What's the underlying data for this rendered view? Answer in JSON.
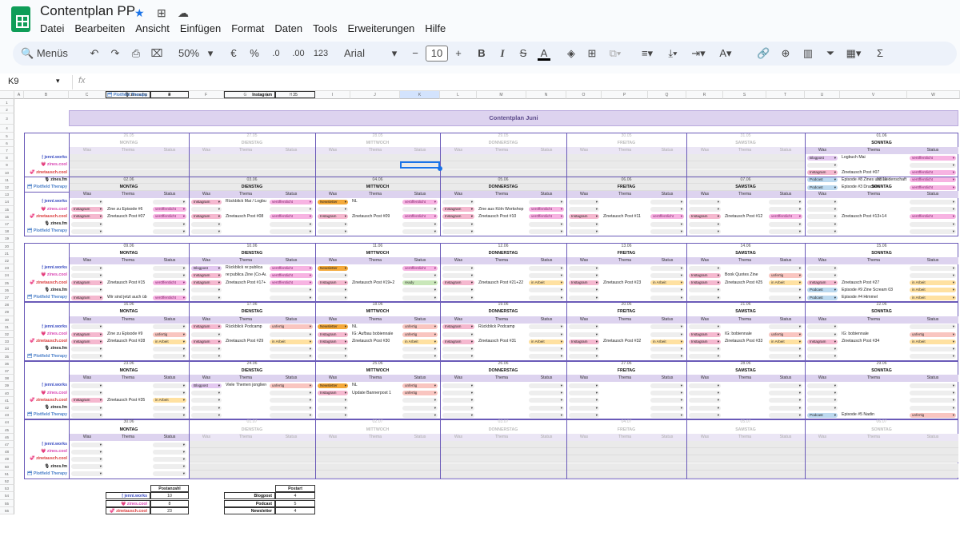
{
  "app": {
    "title": "Contentplan PP",
    "menu": [
      "Datei",
      "Bearbeiten",
      "Ansicht",
      "Einfügen",
      "Format",
      "Daten",
      "Tools",
      "Erweiterungen",
      "Hilfe"
    ]
  },
  "toolbar": {
    "search": "Menüs",
    "zoom": "50%",
    "currency": "€",
    "percent": "%",
    "dec_less": ".0",
    "dec_more": ".00",
    "format123": "123",
    "font": "Arial",
    "font_size": "10"
  },
  "formula_bar": {
    "cell": "K9",
    "fx": "fx"
  },
  "columns": [
    "A",
    "B",
    "C",
    "D",
    "E",
    "F",
    "G",
    "H",
    "I",
    "J",
    "K",
    "L",
    "M",
    "N",
    "O",
    "P",
    "Q",
    "R",
    "S",
    "T",
    "U",
    "V",
    "W"
  ],
  "sheet": {
    "title": "Contentplan Juni"
  },
  "labels": {
    "was": "Was",
    "thema": "Thema",
    "status": "Status"
  },
  "days": [
    "MONTAG",
    "DIENSTAG",
    "MITTWOCH",
    "DONNERSTAG",
    "FREITAG",
    "SAMSTAG",
    "SONNTAG"
  ],
  "channels": [
    {
      "label": "jenni.works",
      "icon": "🕯",
      "color": "#3c4ec2"
    },
    {
      "label": "zines.cool",
      "icon": "💗",
      "color": "#d946b3"
    },
    {
      "label": "zinetausch.cool",
      "icon": "💞",
      "color": "#d93a3a"
    },
    {
      "label": "zines.fm",
      "icon": "🎙",
      "color": "#222222"
    },
    {
      "label": "Plotfield Therapy",
      "icon": "🗂",
      "color": "#4a7fc8"
    }
  ],
  "weeks": [
    {
      "dates": [
        "26.05",
        "27.05",
        "28.05",
        "29.05",
        "30.05",
        "31.05",
        "01.06"
      ],
      "faded": [
        true,
        true,
        true,
        true,
        true,
        true,
        false
      ],
      "cells": [
        {
          "day": 6,
          "row": 0,
          "was": "Blogpost",
          "thema": "Logbuch Mai",
          "status": "veröffentlicht"
        },
        {
          "day": 6,
          "row": 2,
          "was": "Instagram",
          "thema": "Zinetausch Post #07",
          "status": "veröffentlicht"
        },
        {
          "day": 6,
          "row": 3,
          "was": "Podcast",
          "thema": "Episode #8 Zines und Leidenschaft",
          "status": "veröffentlicht"
        },
        {
          "day": 6,
          "row": 4,
          "was": "Podcast",
          "thema": "Episode #3 Drachen",
          "status": "veröffentlicht"
        }
      ]
    },
    {
      "dates": [
        "02.06",
        "03.06",
        "04.06",
        "05.06",
        "06.06",
        "07.06",
        "08.06"
      ],
      "faded": [
        false,
        false,
        false,
        false,
        false,
        false,
        false
      ],
      "cells": [
        {
          "day": 0,
          "row": 1,
          "was": "Instagram",
          "thema": "Zine zu Episode #6",
          "status": "veröffentlicht"
        },
        {
          "day": 0,
          "row": 2,
          "was": "Instagram",
          "thema": "Zinetausch Post #07",
          "status": "veröffentlicht"
        },
        {
          "day": 1,
          "row": 0,
          "was": "Instagram",
          "thema": "Rückblick Mai / Logbuch",
          "status": "veröffentlicht"
        },
        {
          "day": 1,
          "row": 2,
          "was": "Instagram",
          "thema": "Zinetausch Post #08",
          "status": "veröffentlicht"
        },
        {
          "day": 2,
          "row": 0,
          "was": "Newsletter",
          "thema": "NL",
          "status": "veröffentlicht"
        },
        {
          "day": 2,
          "row": 2,
          "was": "Instagram",
          "thema": "Zinetausch Post #09",
          "status": "veröffentlicht"
        },
        {
          "day": 3,
          "row": 1,
          "was": "Instagram",
          "thema": "Zine aus Köln Workshop",
          "status": "veröffentlicht"
        },
        {
          "day": 3,
          "row": 2,
          "was": "Instagram",
          "thema": "Zinetausch Post #10",
          "status": "veröffentlicht"
        },
        {
          "day": 4,
          "row": 2,
          "was": "Instagram",
          "thema": "Zinetausch Post #11",
          "status": "veröffentlicht"
        },
        {
          "day": 5,
          "row": 2,
          "was": "Instagram",
          "thema": "Zinetausch Post #12",
          "status": "veröffentlicht"
        },
        {
          "day": 6,
          "row": 2,
          "was": "",
          "thema": "Zinetausch Post #13+14",
          "status": "veröffentlicht"
        }
      ]
    },
    {
      "dates": [
        "09.06",
        "10.06",
        "11.06",
        "12.06",
        "13.06",
        "14.06",
        "15.06"
      ],
      "faded": [
        false,
        false,
        false,
        false,
        false,
        false,
        false
      ],
      "cells": [
        {
          "day": 0,
          "row": 2,
          "was": "Instagram",
          "thema": "Zinetausch Post #15",
          "status": "veröffentlicht"
        },
        {
          "day": 0,
          "row": 4,
          "was": "Instagram",
          "thema": "Wir sind jetzt auch üb",
          "status": "veröffentlicht"
        },
        {
          "day": 1,
          "row": 0,
          "was": "Blogpost",
          "thema": "Rückblick re:publica",
          "status": "veröffentlicht"
        },
        {
          "day": 1,
          "row": 1,
          "was": "Instagram",
          "thema": "re:publica Zine (Co-Autor",
          "status": "veröffentlicht"
        },
        {
          "day": 1,
          "row": 2,
          "was": "Instagram",
          "thema": "Zinetausch Post #17+18",
          "status": "veröffentlicht"
        },
        {
          "day": 2,
          "row": 0,
          "was": "Newsletter",
          "thema": "",
          "status": "veröffentlicht"
        },
        {
          "day": 2,
          "row": 2,
          "was": "Instagram",
          "thema": "Zinetausch Post #19+2",
          "status": "ready"
        },
        {
          "day": 3,
          "row": 2,
          "was": "Instagram",
          "thema": "Zinetausch Post #21+22",
          "status": "in Arbeit"
        },
        {
          "day": 4,
          "row": 2,
          "was": "Instagram",
          "thema": "Zinetausch Post #23",
          "status": "in Arbeit"
        },
        {
          "day": 5,
          "row": 1,
          "was": "Instagram",
          "thema": "Book Quotes Zine",
          "status": "unfertig"
        },
        {
          "day": 5,
          "row": 2,
          "was": "Instagram",
          "thema": "Zinetausch Post #25",
          "status": "in Arbeit"
        },
        {
          "day": 6,
          "row": 2,
          "was": "Instagram",
          "thema": "Zinetausch Post #27",
          "status": "in Arbeit"
        },
        {
          "day": 6,
          "row": 3,
          "was": "Podcast",
          "thema": "Episode #9 Zine Scream 03",
          "status": "in Arbeit"
        },
        {
          "day": 6,
          "row": 4,
          "was": "Podcast",
          "thema": "Episode #4 Himmel",
          "status": "in Arbeit"
        }
      ]
    },
    {
      "dates": [
        "16.06",
        "17.06",
        "18.06",
        "19.06",
        "20.06",
        "21.06",
        "22.06"
      ],
      "faded": [
        false,
        false,
        false,
        false,
        false,
        false,
        false
      ],
      "cells": [
        {
          "day": 0,
          "row": 1,
          "was": "Instagram",
          "thema": "Zine zu Episode #9",
          "status": "unfertig"
        },
        {
          "day": 0,
          "row": 2,
          "was": "Instagram",
          "thema": "Zinetausch Post #28",
          "status": "in Arbeit"
        },
        {
          "day": 1,
          "row": 0,
          "was": "Instagram",
          "thema": "Rückblick Podcamp",
          "status": "unfertig"
        },
        {
          "day": 1,
          "row": 2,
          "was": "Instagram",
          "thema": "Zinetausch Post #29",
          "status": "in Arbeit"
        },
        {
          "day": 2,
          "row": 0,
          "was": "Newsletter",
          "thema": "NL",
          "status": "unfertig"
        },
        {
          "day": 2,
          "row": 1,
          "was": "Instagram",
          "thema": "IG: Aufbau bobiennale",
          "status": "unfertig"
        },
        {
          "day": 2,
          "row": 2,
          "was": "Instagram",
          "thema": "Zinetausch Post #30",
          "status": "in Arbeit"
        },
        {
          "day": 3,
          "row": 0,
          "was": "Instagram",
          "thema": "Rückblick Podcamp",
          "status": ""
        },
        {
          "day": 3,
          "row": 2,
          "was": "Instagram",
          "thema": "Zinetausch Post #31",
          "status": "in Arbeit"
        },
        {
          "day": 4,
          "row": 2,
          "was": "Instagram",
          "thema": "Zinetausch Post #32",
          "status": "in Arbeit"
        },
        {
          "day": 5,
          "row": 1,
          "was": "Instagram",
          "thema": "IG: bobiennale",
          "status": "unfertig"
        },
        {
          "day": 5,
          "row": 2,
          "was": "Instagram",
          "thema": "Zinetausch Post #33",
          "status": "in Arbeit"
        },
        {
          "day": 6,
          "row": 1,
          "was": "",
          "thema": "IG: bobiennale",
          "status": "unfertig"
        },
        {
          "day": 6,
          "row": 2,
          "was": "Instagram",
          "thema": "Zinetausch Post #34",
          "status": "in Arbeit"
        }
      ]
    },
    {
      "dates": [
        "23.06",
        "24.06",
        "25.06",
        "26.06",
        "27.06",
        "28.06",
        "29.06"
      ],
      "faded": [
        false,
        false,
        false,
        false,
        false,
        false,
        false
      ],
      "cells": [
        {
          "day": 0,
          "row": 2,
          "was": "Instagram",
          "thema": "Zinetausch Post #35",
          "status": "in Arbeit"
        },
        {
          "day": 1,
          "row": 0,
          "was": "Blogpost",
          "thema": "Viele Themen jonglieren",
          "status": "unfertig"
        },
        {
          "day": 2,
          "row": 0,
          "was": "Newsletter",
          "thema": "NL",
          "status": "unfertig"
        },
        {
          "day": 2,
          "row": 1,
          "was": "Instagram",
          "thema": "Update Bannerpost 1",
          "status": "unfertig"
        },
        {
          "day": 6,
          "row": 4,
          "was": "Podcast",
          "thema": "Episode #5 Nadin",
          "status": "unfertig"
        }
      ]
    },
    {
      "dates": [
        "30.06",
        "01.07",
        "02.07",
        "03.07",
        "04.07",
        "05.07",
        "06.07"
      ],
      "faded": [
        false,
        true,
        true,
        true,
        true,
        true,
        true
      ],
      "cells": []
    }
  ],
  "summary1": {
    "header": "Postanzahl",
    "rows": [
      {
        "label": "jenni.works",
        "value": "10"
      },
      {
        "label": "zines.cool",
        "value": "8"
      },
      {
        "label": "zinetausch.cool",
        "value": "23"
      },
      {
        "label": "zines.fm",
        "value": "2"
      },
      {
        "label": "Plotfield Therapy",
        "value": "4"
      }
    ]
  },
  "summary2": {
    "header": "Postart",
    "rows": [
      {
        "label": "Blogpost",
        "value": "4"
      },
      {
        "label": "Podcast",
        "value": "5"
      },
      {
        "label": "Newsletter",
        "value": "4"
      },
      {
        "label": "Instagram",
        "value": "35"
      }
    ]
  },
  "colors": {
    "Instagram": "#f5b8cf",
    "Blogpost": "#e3c8f0",
    "Newsletter": "#f4a93a",
    "Podcast": "#bcd9ef",
    "veröffentlicht": "#f7b3e2",
    "in Arbeit": "#ffe1a1",
    "unfertig": "#f9c5c0",
    "ready": "#c9e7b9",
    "header": "#ddd3ef"
  }
}
